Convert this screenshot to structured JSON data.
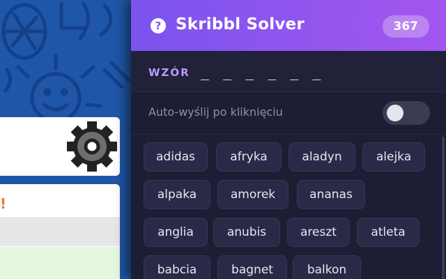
{
  "panel": {
    "title": "Skribbl Solver",
    "word_count": "367",
    "pattern_label": "WZÓR",
    "pattern_value": "_ _ _ _ _ _",
    "auto_send_label": "Auto-wyślij po kliknięciu",
    "auto_send_enabled": false,
    "words": [
      "adidas",
      "afryka",
      "aladyn",
      "alejka",
      "alpaka",
      "amorek",
      "ananas",
      "anglia",
      "anubis",
      "areszt",
      "atleta",
      "babcia",
      "bagnet",
      "balkon"
    ]
  },
  "game": {
    "partial_text": "!"
  },
  "colors": {
    "accent": "#7b54ee",
    "accent_end": "#a356ee",
    "panel_bg": "#1d1d33",
    "chip_bg": "#2a2a48",
    "pattern_label": "#b99cff",
    "game_bg": "#1f56a8"
  },
  "icons": {
    "help": "question-circle-icon",
    "settings": "gear-icon"
  }
}
